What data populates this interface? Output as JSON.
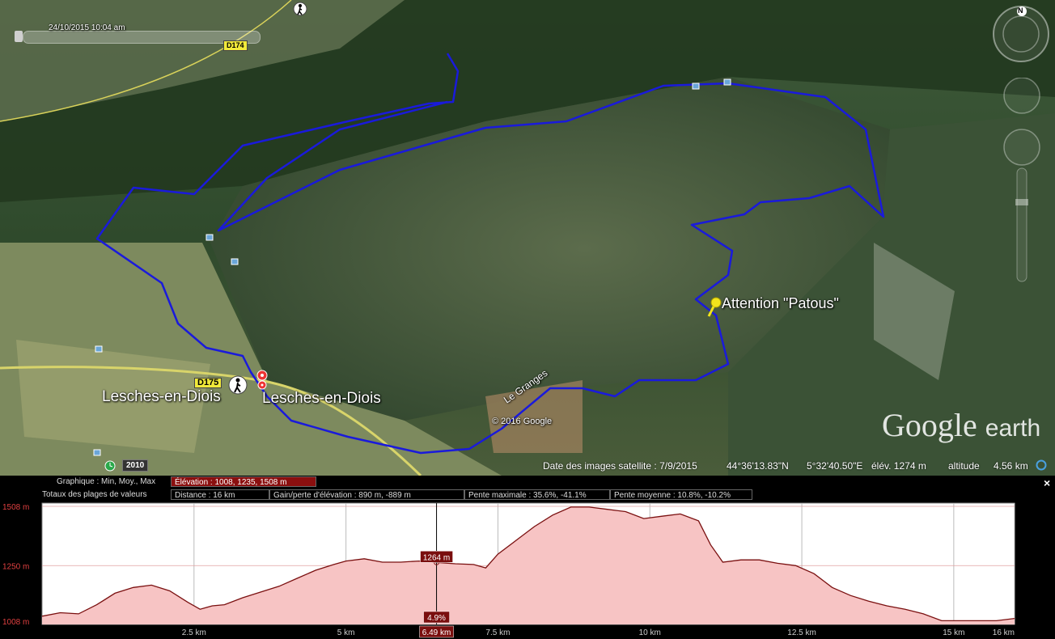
{
  "map": {
    "timestamp": "24/10/2015  10:04 am",
    "roads": [
      "D174",
      "D175"
    ],
    "places": [
      "Lesches-en-Diois",
      "Lesches-en-Diois"
    ],
    "placemark": "Attention \"Patous\"",
    "street": "Le Granges",
    "copyright": "© 2016 Google",
    "logo_google": "Google",
    "logo_earth": "earth",
    "year": "2010",
    "compass_n": "N",
    "status": {
      "date": "Date des images satellite : 7/9/2015",
      "lat": "44°36'13.83\"N",
      "lon": "5°32'40.50\"E",
      "elev": "élév. 1274 m",
      "alt_label": "altitude",
      "alt_value": "4.56 km"
    },
    "colors": {
      "track": "#1a1adb"
    }
  },
  "panel": {
    "graph_label": "Graphique : Min, Moy., Max",
    "graph_value": "Élévation : 1008, 1235, 1508 m",
    "totals_label": "Totaux des plages de valeurs",
    "distance": "Distance : 16 km",
    "gain": "Gain/perte d'élévation : 890 m, -889 m",
    "max_slope": "Pente maximale : 35.6%, -41.1%",
    "avg_slope": "Pente moyenne : 10.8%, -10.2%",
    "close": "×"
  },
  "chart_data": {
    "type": "area",
    "ylabels": [
      "1508 m",
      "1250 m",
      "1008 m"
    ],
    "yticks": [
      1508,
      1250,
      1008
    ],
    "ylim": [
      1008,
      1508
    ],
    "xlabels": [
      "2.5 km",
      "5 km",
      "7.5 km",
      "10 km",
      "12.5 km",
      "15 km",
      "16 km"
    ],
    "xticks": [
      2.5,
      5,
      7.5,
      10,
      12.5,
      15,
      16
    ],
    "xlim": [
      0,
      16
    ],
    "cursor": {
      "x": 6.49,
      "x_label": "6.49 km",
      "elev_label": "1264 m",
      "slope_label": "4.9%"
    },
    "x": [
      0,
      0.3,
      0.6,
      0.9,
      1.2,
      1.5,
      1.8,
      2.1,
      2.4,
      2.6,
      2.8,
      3.0,
      3.3,
      3.6,
      3.9,
      4.2,
      4.5,
      4.8,
      5.0,
      5.3,
      5.6,
      5.9,
      6.2,
      6.49,
      6.8,
      7.1,
      7.3,
      7.5,
      7.8,
      8.1,
      8.4,
      8.7,
      9.0,
      9.3,
      9.6,
      9.9,
      10.2,
      10.5,
      10.8,
      11.0,
      11.2,
      11.5,
      11.8,
      12.1,
      12.4,
      12.7,
      13.0,
      13.3,
      13.6,
      13.9,
      14.2,
      14.5,
      14.8,
      15.1,
      15.4,
      15.7,
      16.0
    ],
    "y": [
      1030,
      1045,
      1040,
      1080,
      1130,
      1155,
      1165,
      1140,
      1090,
      1060,
      1075,
      1080,
      1110,
      1135,
      1160,
      1195,
      1230,
      1255,
      1270,
      1280,
      1265,
      1265,
      1270,
      1264,
      1258,
      1255,
      1240,
      1300,
      1360,
      1420,
      1470,
      1505,
      1505,
      1495,
      1485,
      1455,
      1465,
      1475,
      1445,
      1340,
      1265,
      1275,
      1275,
      1260,
      1250,
      1215,
      1155,
      1120,
      1095,
      1075,
      1060,
      1040,
      1010,
      1010,
      1010,
      1010,
      1020
    ]
  }
}
